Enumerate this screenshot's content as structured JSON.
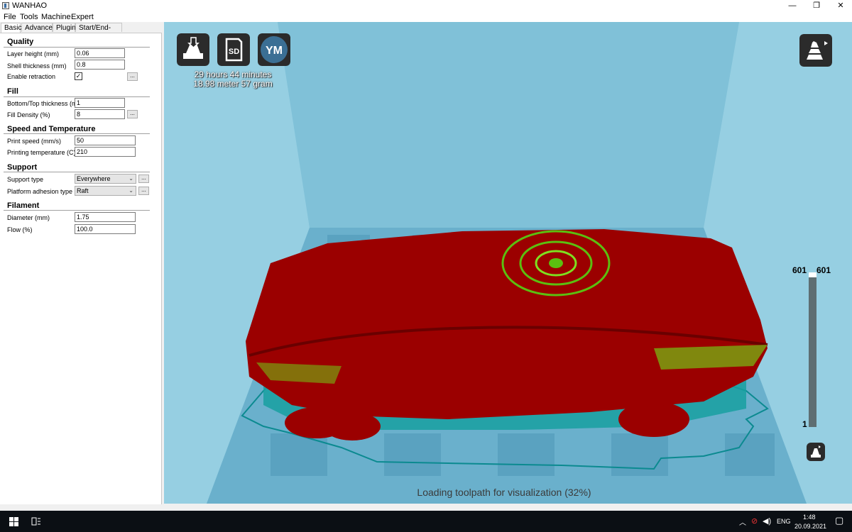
{
  "window": {
    "title": "WANHAO",
    "min": "—",
    "restore": "❐",
    "close": "✕"
  },
  "menu": [
    "File",
    "Tools",
    "Machine",
    "Expert"
  ],
  "tabs": [
    "Basic",
    "Advanced",
    "Plugins",
    "Start/End-GCode"
  ],
  "sections": {
    "quality": {
      "title": "Quality",
      "layer_height_label": "Layer height (mm)",
      "layer_height": "0.06",
      "shell_label": "Shell thickness (mm)",
      "shell": "0.8",
      "retraction_label": "Enable retraction",
      "retraction_checked": "✓"
    },
    "fill": {
      "title": "Fill",
      "bottom_top_label": "Bottom/Top thickness (mm)",
      "bottom_top": "1",
      "density_label": "Fill Density (%)",
      "density": "8"
    },
    "speed": {
      "title": "Speed and Temperature",
      "print_speed_label": "Print speed (mm/s)",
      "print_speed": "50",
      "temp_label": "Printing temperature (C)",
      "temp": "210"
    },
    "support": {
      "title": "Support",
      "type_label": "Support type",
      "type": "Everywhere",
      "adhesion_label": "Platform adhesion type",
      "adhesion": "Raft"
    },
    "filament": {
      "title": "Filament",
      "diameter_label": "Diameter (mm)",
      "diameter": "1.75",
      "flow_label": "Flow (%)",
      "flow": "100.0"
    }
  },
  "dots_label": "...",
  "viewport": {
    "sd_label": "SD",
    "ym_label": "YM",
    "print_time": "29 hours 44 minutes",
    "print_material": "18.98 meter 57 gram",
    "layer_top_left": "601",
    "layer_top_right": "601",
    "layer_bottom": "1",
    "layer_position": 1.0,
    "loading": "Loading toolpath for visualization (32%)",
    "colors": {
      "model": "#9b0000",
      "infill": "#5bbf10",
      "support": "#18a0a0",
      "background": "#86c6dc"
    }
  },
  "taskbar": {
    "lang": "ENG",
    "time": "1:48",
    "date": "20.09.2021"
  }
}
